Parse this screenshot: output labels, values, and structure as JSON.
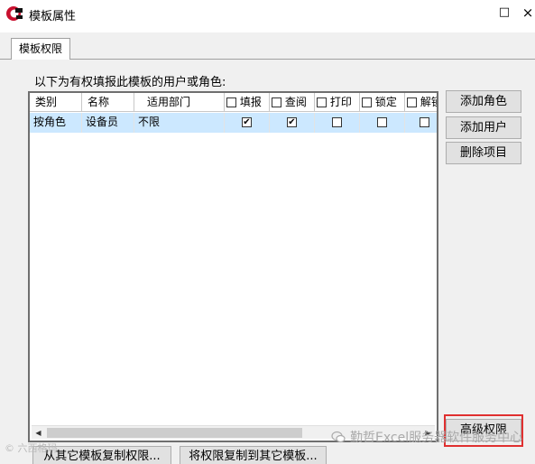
{
  "window": {
    "title": "模板属性",
    "minimize_glyph": "□",
    "close_glyph": "×"
  },
  "tabs": [
    {
      "label": "模板权限"
    }
  ],
  "prompt": "以下为有权填报此模板的用户或角色:",
  "grid": {
    "columns": [
      {
        "label": "类别",
        "has_checkbox": false
      },
      {
        "label": "名称",
        "has_checkbox": false
      },
      {
        "label": "适用部门",
        "has_checkbox": false
      },
      {
        "label": "填报",
        "has_checkbox": true
      },
      {
        "label": "查阅",
        "has_checkbox": true
      },
      {
        "label": "打印",
        "has_checkbox": true
      },
      {
        "label": "锁定",
        "has_checkbox": true
      },
      {
        "label": "解锁",
        "has_checkbox": true
      }
    ],
    "rows": [
      {
        "category": "按角色",
        "name": "设备员",
        "department": "不限",
        "fill": true,
        "view": true,
        "print": false,
        "lock": false,
        "unlock": false
      }
    ]
  },
  "buttons": {
    "add_role": "添加角色",
    "add_user": "添加用户",
    "delete_item": "删除项目",
    "advanced": "高级权限",
    "copy_from": "从其它模板复制权限...",
    "copy_to": "将权限复制到其它模板..."
  },
  "check_glyph": "✔",
  "watermarks": {
    "left": "© 六西格玛",
    "right": "勤哲Excel服务器软件服务中心"
  },
  "colors": {
    "selected_row": "#cce8ff",
    "highlight": "#e03030",
    "brand_red": "#c8102e"
  },
  "icons": {
    "app": "app-logo-icon",
    "wechat": "wechat-icon"
  }
}
